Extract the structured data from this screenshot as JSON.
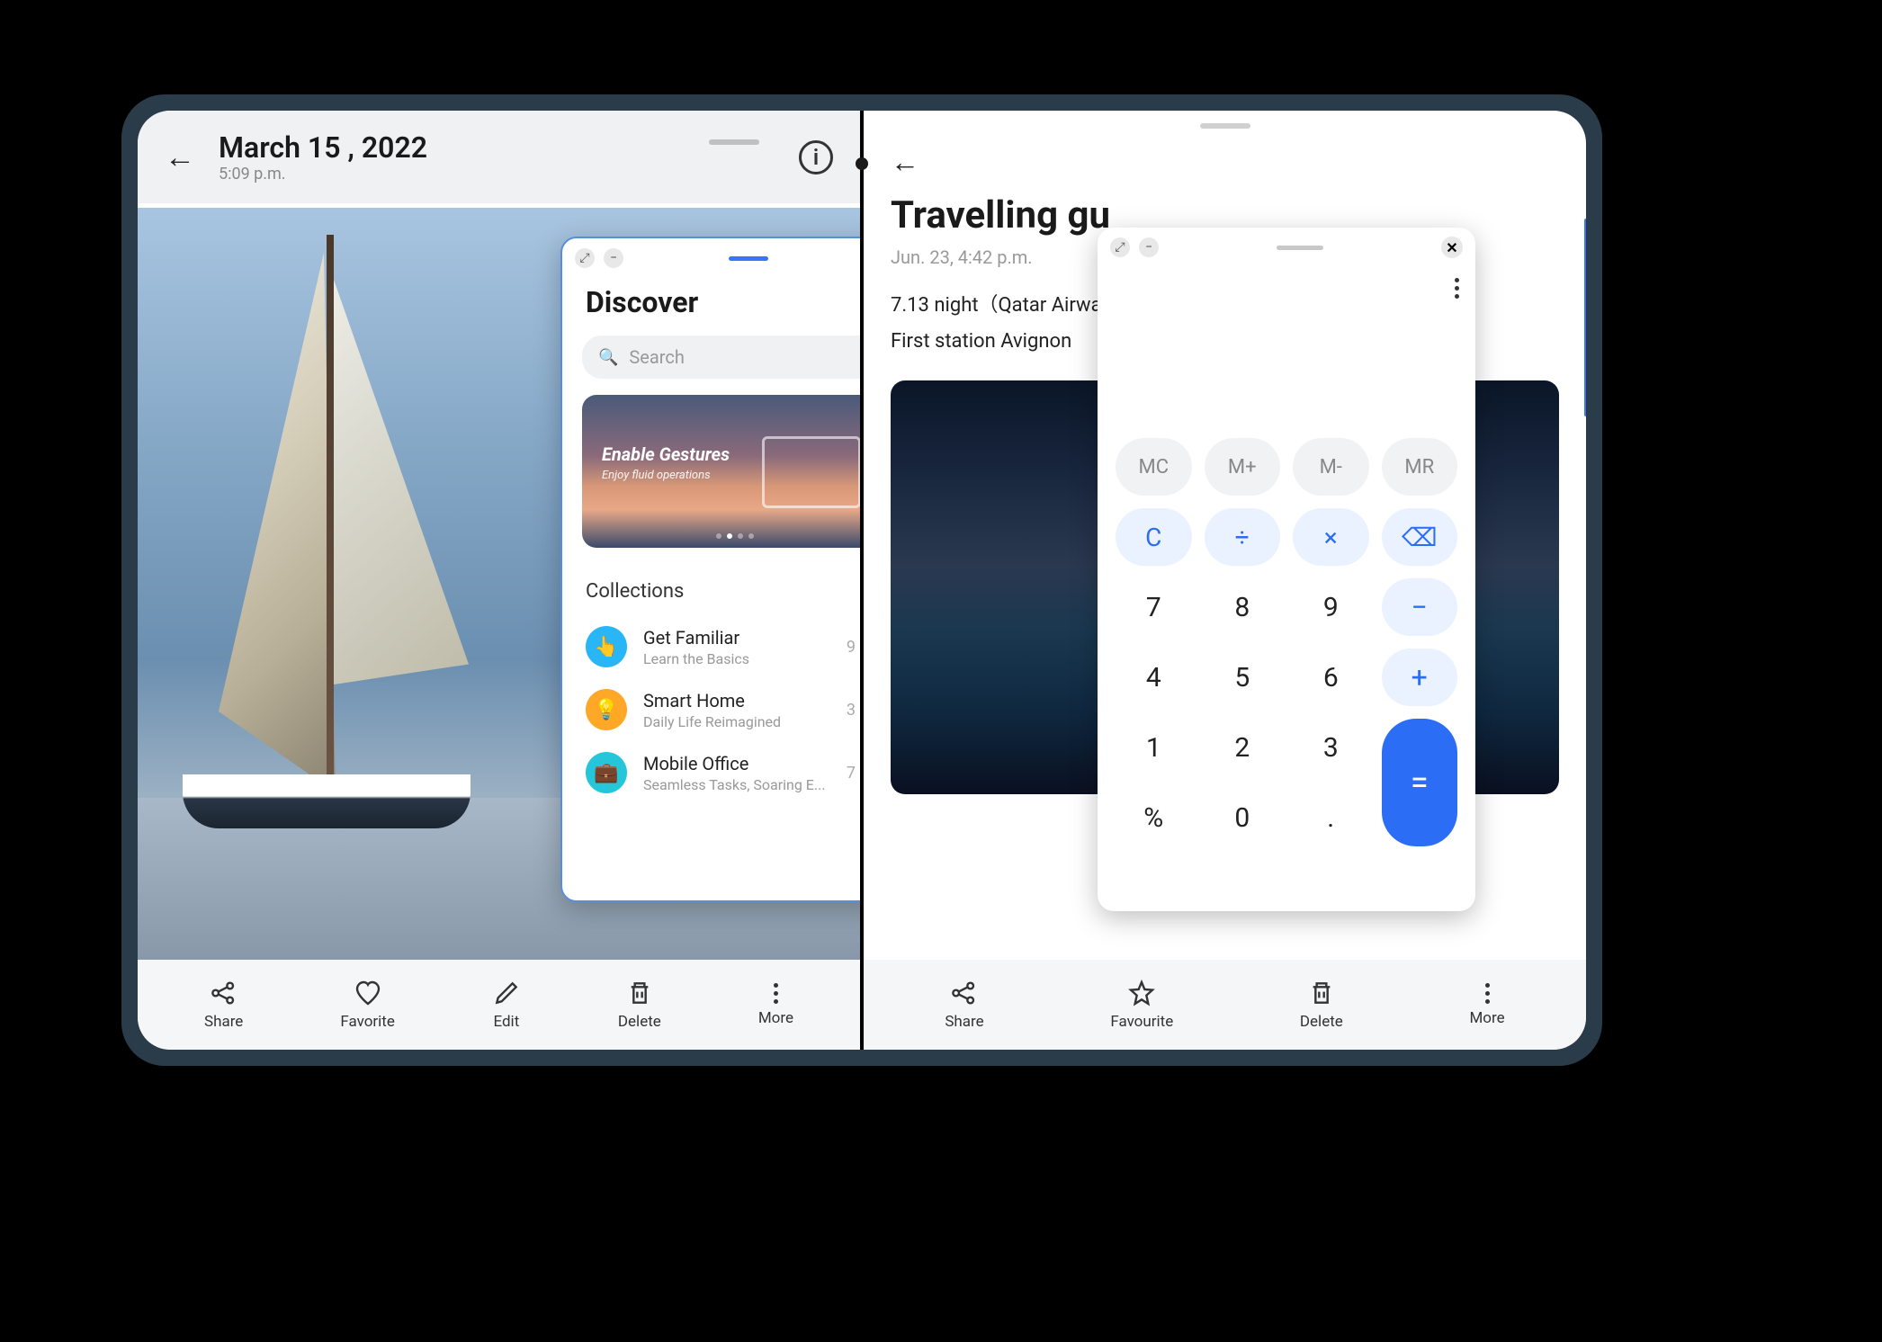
{
  "gallery": {
    "date": "March 15 , 2022",
    "time": "5:09 p.m.",
    "bottom_bar": [
      {
        "label": "Share"
      },
      {
        "label": "Favorite"
      },
      {
        "label": "Edit"
      },
      {
        "label": "Delete"
      },
      {
        "label": "More"
      }
    ]
  },
  "discover": {
    "title": "Discover",
    "search_placeholder": "Search",
    "banner": {
      "title": "Enable Gestures",
      "subtitle": "Enjoy fluid operations"
    },
    "collections_label": "Collections",
    "collections": [
      {
        "name": "Get Familiar",
        "subtitle": "Learn the Basics",
        "count": "9"
      },
      {
        "name": "Smart Home",
        "subtitle": "Daily Life Reimagined",
        "count": "3"
      },
      {
        "name": "Mobile Office",
        "subtitle": "Seamless Tasks, Soaring E...",
        "count": "7"
      }
    ]
  },
  "notes": {
    "title": "Travelling gu",
    "date": "Jun. 23, 4:42 p.m.",
    "line1": "7.13 night（Qatar Airwa",
    "line2": "First station  Avignon",
    "bottom_bar": [
      {
        "label": "Share"
      },
      {
        "label": "Favourite"
      },
      {
        "label": "Delete"
      },
      {
        "label": "More"
      }
    ]
  },
  "calculator": {
    "mem": [
      "MC",
      "M+",
      "M-",
      "MR"
    ],
    "row_ops": [
      "C",
      "÷",
      "×"
    ],
    "backspace": "⌫",
    "numbers": {
      "r1": [
        "7",
        "8",
        "9"
      ],
      "r2": [
        "4",
        "5",
        "6"
      ],
      "r3": [
        "1",
        "2",
        "3"
      ],
      "r4": [
        "%",
        "0",
        "."
      ]
    },
    "side_ops": {
      "minus": "−",
      "plus": "+",
      "equals": "="
    }
  }
}
